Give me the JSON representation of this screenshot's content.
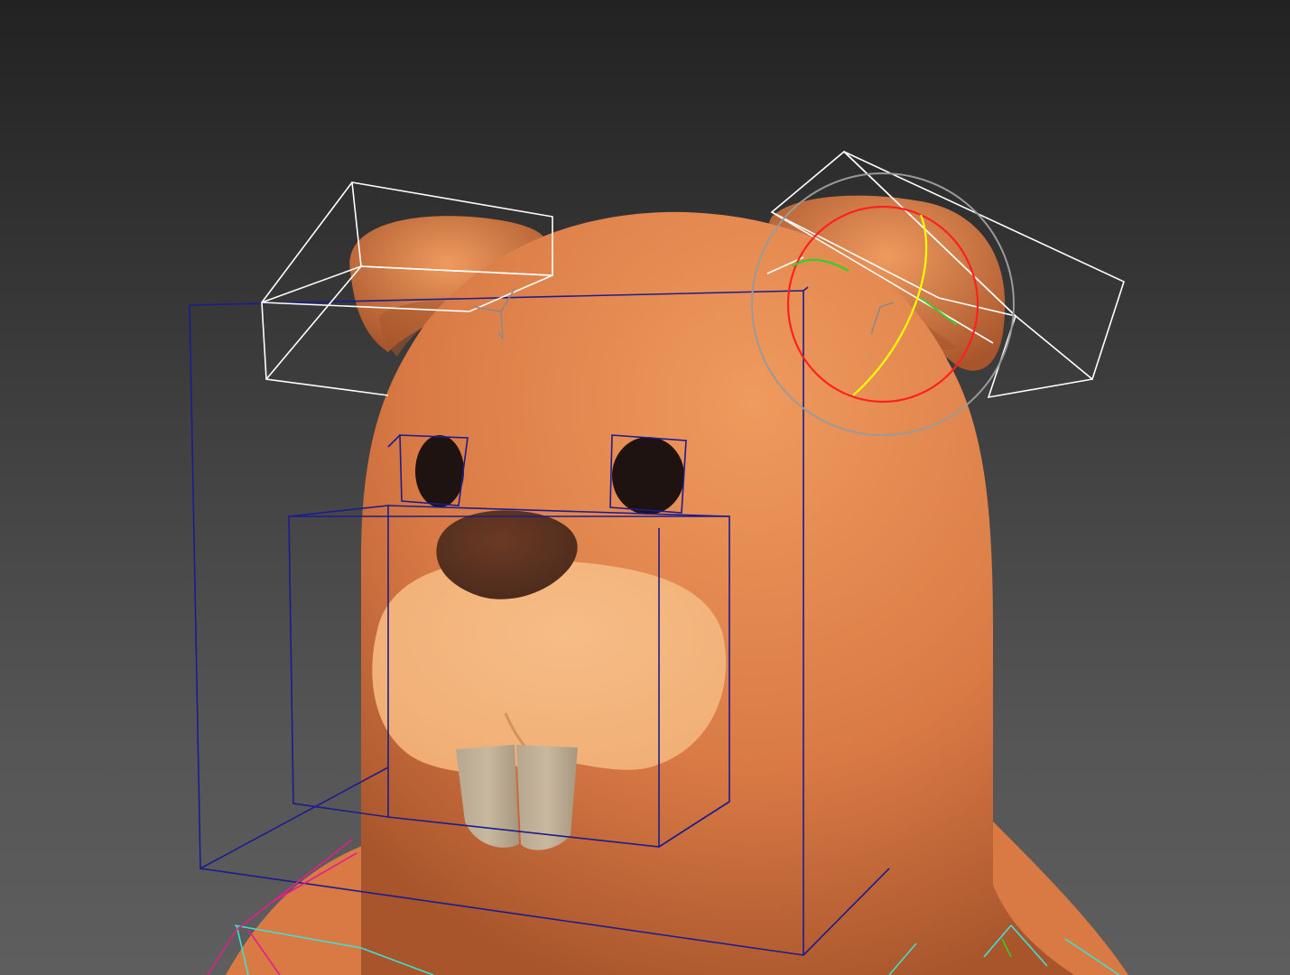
{
  "viewport": {
    "background_top": "#222222",
    "background_bottom": "#5e5e5e"
  },
  "character": {
    "skin_color": "#d97a45",
    "skin_highlight": "#ef9a5e",
    "skin_shadow": "#a8552c",
    "muzzle_color": "#f0ae74",
    "nose_color": "#4a2a1c",
    "eye_color": "#1f1312",
    "teeth_color": "#c9b8a0"
  },
  "rig": {
    "ear_controller_color": "#ffffff",
    "head_controller_color": "#1c1c8c",
    "rotate_gizmo_outer_color": "#9a9a9a",
    "rotate_gizmo_x_color": "#ff2020",
    "rotate_gizmo_y_color": "#ffff00",
    "rotate_gizmo_z_color": "#30d030",
    "spine_controller_color": "#40e0d0",
    "arm_controller_color": "#e0208c"
  }
}
